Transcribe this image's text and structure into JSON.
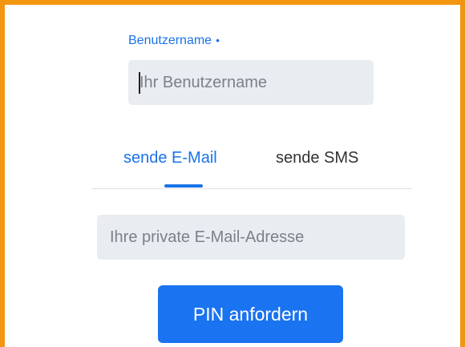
{
  "form": {
    "username_label": "Benutzername",
    "required_marker": "•",
    "username_placeholder": "Ihr Benutzername",
    "username_value": "",
    "tabs": [
      {
        "label": "sende E-Mail",
        "active": true
      },
      {
        "label": "sende SMS",
        "active": false
      }
    ],
    "email_placeholder": "Ihre private E-Mail-Adresse",
    "email_value": "",
    "submit_label": "PIN anfordern"
  },
  "colors": {
    "accent": "#1a73e8",
    "frame_border": "#f2960f",
    "input_background": "#e9ecf1",
    "button_background": "#1a73f0"
  }
}
